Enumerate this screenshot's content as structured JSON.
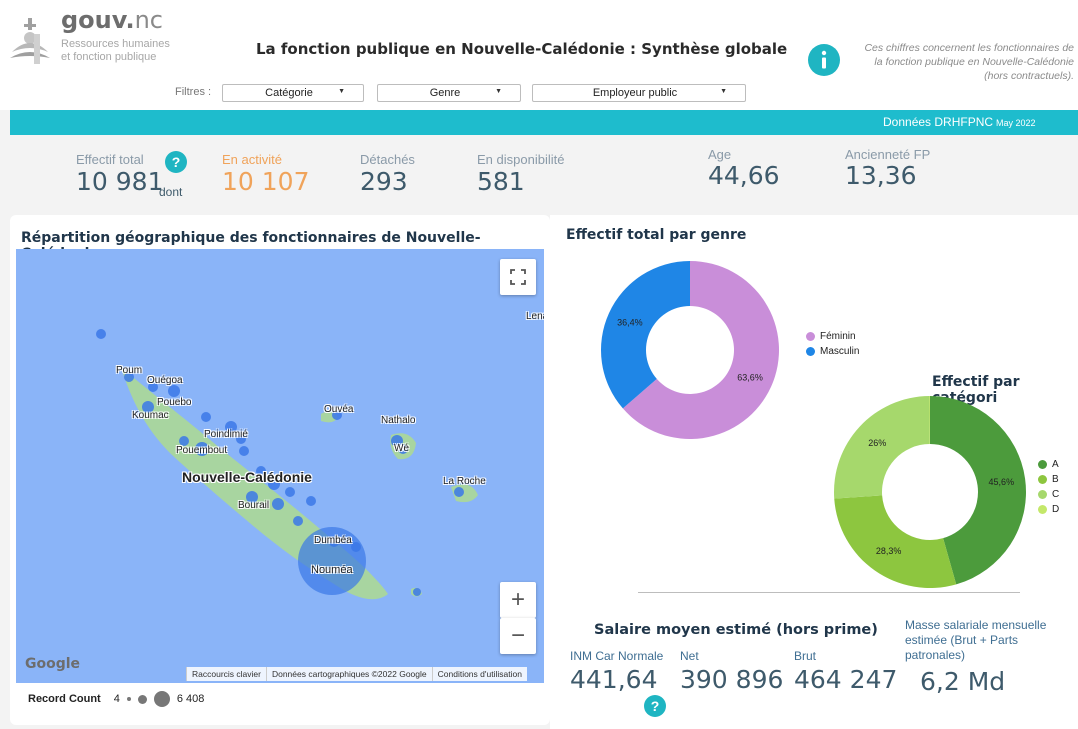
{
  "header": {
    "logo_main": "gouv.",
    "logo_suffix": "nc",
    "logo_sub_1": "Ressources humaines",
    "logo_sub_2": "et fonction publique",
    "title": "La fonction publique en Nouvelle-Calédonie : Synthèse globale",
    "info_icon": "info-icon",
    "info_text_1": "Ces chiffres concernent les fonctionnaires de",
    "info_text_2": "la fonction publique en Nouvelle-Calédonie",
    "info_text_3": "(hors contractuels)."
  },
  "filters": {
    "label": "Filtres :",
    "items": [
      {
        "label": "Catégorie"
      },
      {
        "label": "Genre"
      },
      {
        "label": "Employeur public"
      }
    ]
  },
  "banner": {
    "source": "Données DRHFPNC",
    "date": "May 2022",
    "color": "#1ebccd"
  },
  "kpis": {
    "total_label": "Effectif total",
    "total_value": "10 981",
    "total_suffix": "dont",
    "help_icon": "?",
    "active_label": "En activité",
    "active_value": "10 107",
    "detached_label": "Détachés",
    "detached_value": "293",
    "available_label": "En disponibilité",
    "available_value": "581",
    "age_label": "Age",
    "age_value": "44,66",
    "seniority_label": "Ancienneté FP",
    "seniority_value": "13,36"
  },
  "map": {
    "title": "Répartition géographique des fonctionnaires de Nouvelle-Calédonie",
    "places": {
      "poum": "Poum",
      "ouegoa": "Ouégoa",
      "pouebo": "Pouebo",
      "koumac": "Koumac",
      "ouvea": "Ouvéa",
      "nathalo": "Nathalo",
      "we": "Wé",
      "poindimie": "Poindimié",
      "pouembout": "Pouembout",
      "nouvelle_caledonie": "Nouvelle-Calédonie",
      "la_roche": "La Roche",
      "bourail": "Bourail",
      "dumbea": "Dumbéa",
      "noumea": "Nouméa",
      "lena": "Lena"
    },
    "google": "Google",
    "footer_shortcuts": "Raccourcis clavier",
    "footer_data": "Données cartographiques ©2022 Google",
    "footer_terms": "Conditions d'utilisation",
    "zoom_in": "+",
    "zoom_out": "−",
    "legend_label": "Record Count",
    "legend_min": "4",
    "legend_max": "6 408"
  },
  "gender": {
    "title": "Effectif total par genre",
    "legend": [
      {
        "name": "Féminin",
        "color": "#c98ed9"
      },
      {
        "name": "Masculin",
        "color": "#1f86e6"
      }
    ]
  },
  "category": {
    "title": "Effectif par catégori",
    "legend": [
      {
        "name": "A",
        "color": "#4c9b3c"
      },
      {
        "name": "B",
        "color": "#8dc63f"
      },
      {
        "name": "C",
        "color": "#a6d86c"
      },
      {
        "name": "D",
        "color": "#c4e86a"
      }
    ]
  },
  "chart_data": [
    {
      "type": "pie",
      "title": "Effectif total par genre",
      "categories": [
        "Féminin",
        "Masculin"
      ],
      "values": [
        63.6,
        36.4
      ],
      "labels": [
        "63,6%",
        "36,4%"
      ],
      "colors": [
        "#c98ed9",
        "#1f86e6"
      ],
      "legend": "right"
    },
    {
      "type": "pie",
      "title": "Effectif par catégori",
      "categories": [
        "A",
        "B",
        "C",
        "D"
      ],
      "values": [
        45.6,
        28.3,
        26,
        0.1
      ],
      "labels": [
        "45,6%",
        "28,3%",
        "26%",
        ""
      ],
      "colors": [
        "#4c9b3c",
        "#8dc63f",
        "#a6d86c",
        "#c4e86a"
      ],
      "legend": "right"
    }
  ],
  "salary": {
    "title": "Salaire moyen estimé (hors prime)",
    "inm_label": "INM Car Normale",
    "inm_value": "441,64",
    "net_label": "Net",
    "net_value": "390 896",
    "brut_label": "Brut",
    "brut_value": "464 247",
    "mass_label": "Masse salariale mensuelle estimée (Brut + Parts patronales)",
    "mass_value": "6,2 Md",
    "help_icon": "?"
  }
}
